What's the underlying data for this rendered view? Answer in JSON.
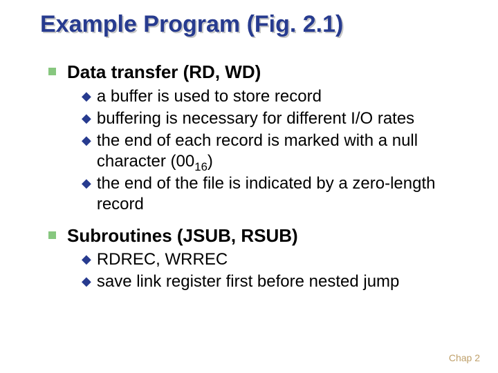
{
  "title": "Example Program (Fig. 2.1)",
  "sections": [
    {
      "heading": "Data transfer (RD, WD)",
      "items": [
        {
          "text": "a buffer is used to store record"
        },
        {
          "text": "buffering is necessary for different I/O rates"
        },
        {
          "prefix": "the end of each record is marked with a null character (00",
          "sub": "16",
          "suffix": ")"
        },
        {
          "text": "the end of the file is indicated by a zero-length record"
        }
      ]
    },
    {
      "heading": "Subroutines (JSUB, RSUB)",
      "items": [
        {
          "text": "RDREC, WRREC"
        },
        {
          "text": "save link register first before nested jump"
        }
      ]
    }
  ],
  "footer": "Chap 2"
}
